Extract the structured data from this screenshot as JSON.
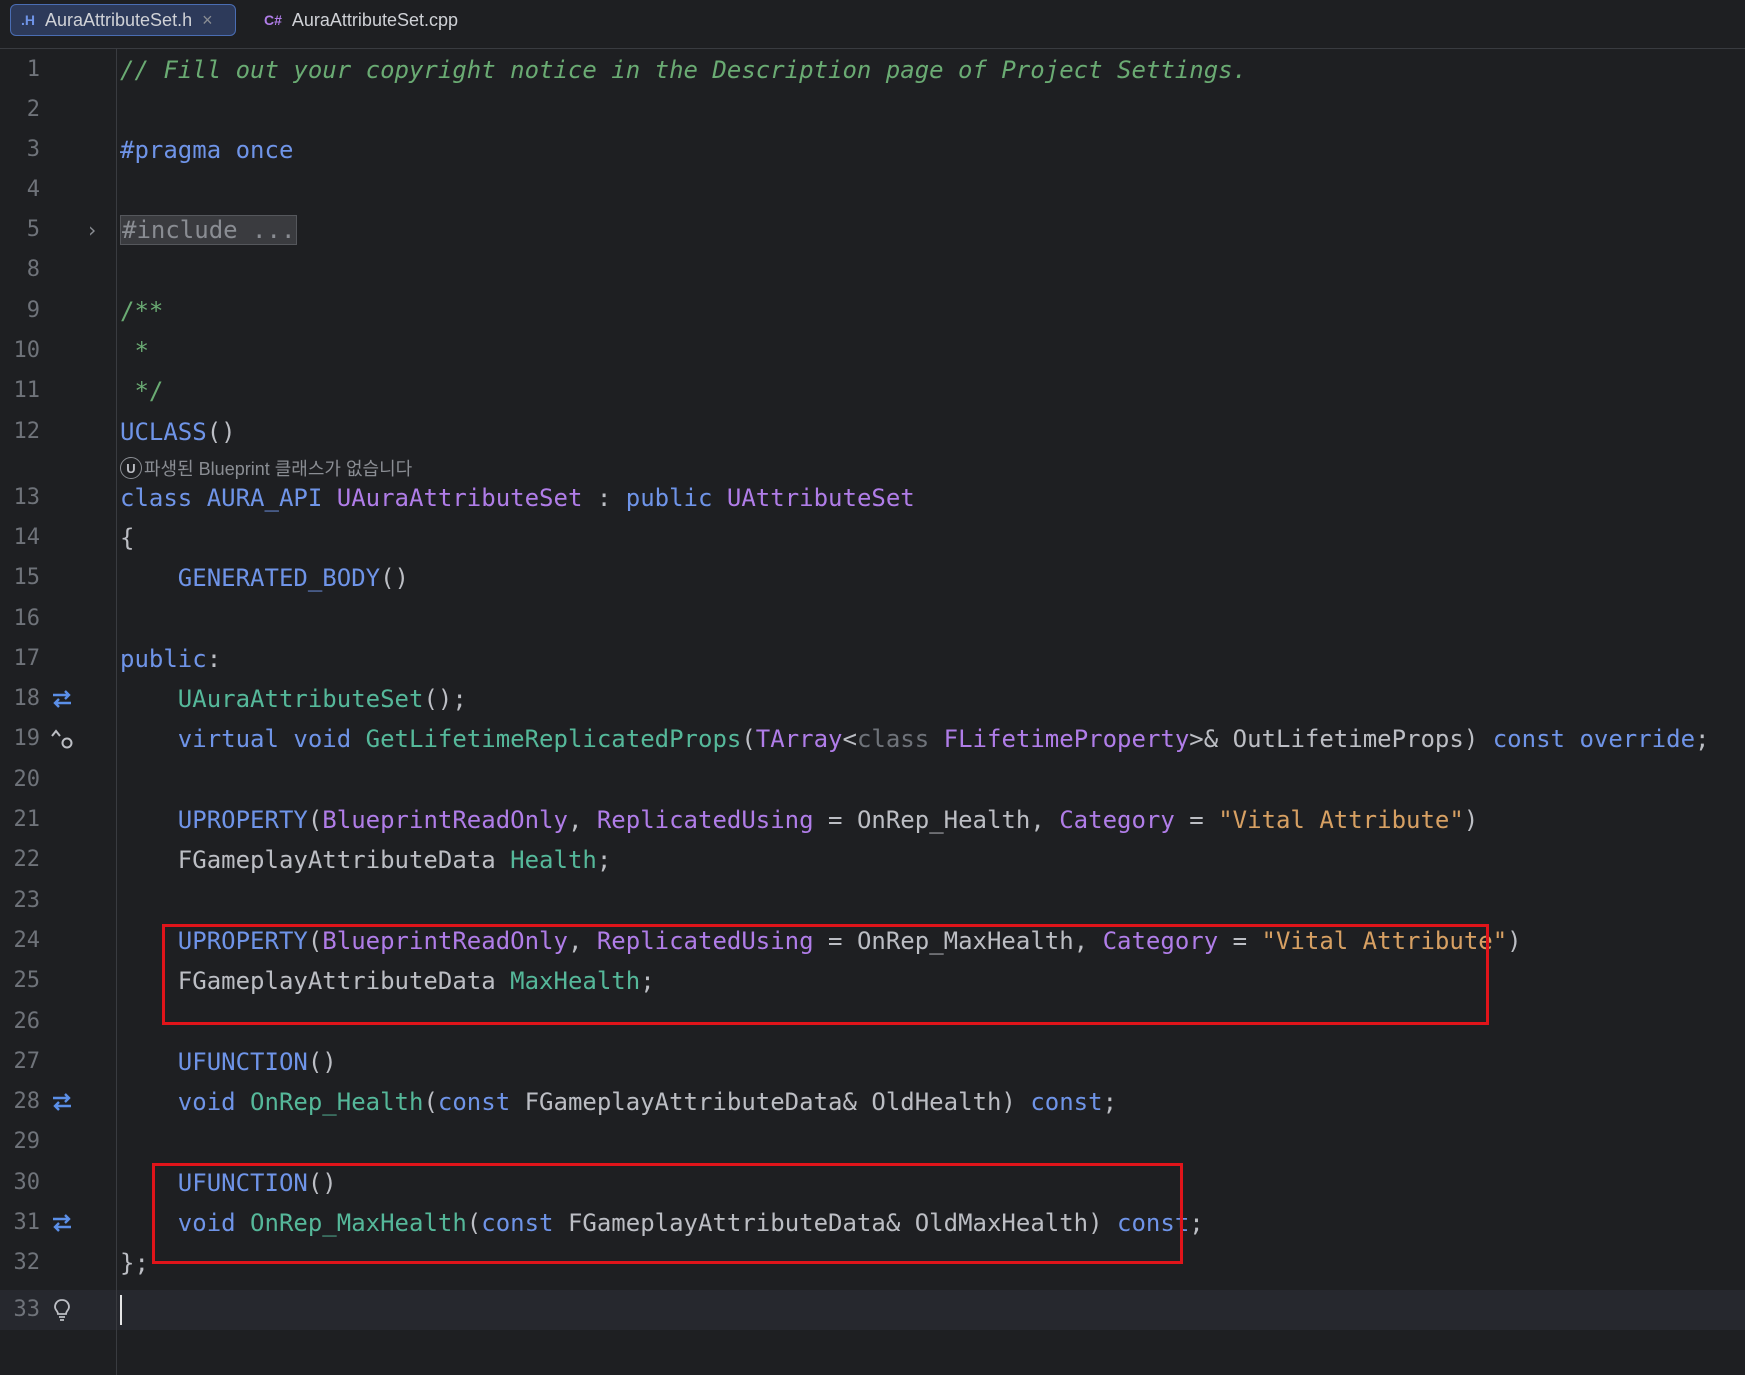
{
  "tabs": [
    {
      "icon": ".H",
      "label": "AuraAttributeSet.h",
      "close": "×",
      "active": true
    },
    {
      "icon": "C#",
      "label": "AuraAttributeSet.cpp",
      "active": false
    }
  ],
  "line_numbers": [
    "1",
    "2",
    "3",
    "4",
    "5",
    "8",
    "9",
    "10",
    "11",
    "12",
    "13",
    "14",
    "15",
    "16",
    "17",
    "18",
    "19",
    "20",
    "21",
    "22",
    "23",
    "24",
    "25",
    "26",
    "27",
    "28",
    "29",
    "30",
    "31",
    "32",
    "33"
  ],
  "code": {
    "l1": "// Fill out your copyright notice in the Description page of Project Settings.",
    "l3_kw": "#pragma",
    "l3_rest": " once",
    "l5": "#include ...",
    "l9": "/**",
    "l10": " *",
    "l11": " */",
    "l12_macro": "UCLASS",
    "l12_paren": "()",
    "hint": "파생된 Blueprint 클래스가 없습니다",
    "hint_badge": "U",
    "l13_class": "class",
    "l13_api": "AURA_API",
    "l13_name": "UAuraAttributeSet",
    "l13_colon": " : ",
    "l13_public": "public",
    "l13_base": "UAttributeSet",
    "l14": "{",
    "l15_macro": "GENERATED_BODY",
    "l15_paren": "()",
    "l17_public": "public",
    "l17_colon": ":",
    "l18_fn": "UAuraAttributeSet",
    "l18_rest": "();",
    "l19_virtual": "virtual",
    "l19_void": "void",
    "l19_fn": "GetLifetimeReplicatedProps",
    "l19_p1": "(",
    "l19_tarray": "TArray",
    "l19_lt": "<",
    "l19_class": "class",
    "l19_prop": "FLifetimeProperty",
    "l19_p2": ">& OutLifetimeProps) ",
    "l19_const": "const",
    "l19_override": "override",
    "l19_semi": ";",
    "l21_macro": "UPROPERTY",
    "l21_p1": "(",
    "l21_bro": "BlueprintReadOnly",
    "l21_comma1": ", ",
    "l21_ru": "ReplicatedUsing",
    "l21_eq": " = OnRep_Health, ",
    "l21_cat": "Category",
    "l21_eq2": " = ",
    "l21_str": "\"Vital Attribute\"",
    "l21_p2": ")",
    "l22_type": "FGameplayAttributeData",
    "l22_name": "Health",
    "l22_semi": ";",
    "l24_macro": "UPROPERTY",
    "l24_p1": "(",
    "l24_bro": "BlueprintReadOnly",
    "l24_comma1": ", ",
    "l24_ru": "ReplicatedUsing",
    "l24_eq": " = OnRep_MaxHealth, ",
    "l24_cat": "Category",
    "l24_eq2": " = ",
    "l24_str": "\"Vital Attribute\"",
    "l24_p2": ")",
    "l25_type": "FGameplayAttributeData",
    "l25_name": "MaxHealth",
    "l25_semi": ";",
    "l27_macro": "UFUNCTION",
    "l27_paren": "()",
    "l28_void": "void",
    "l28_fn": "OnRep_Health",
    "l28_p1": "(",
    "l28_const": "const",
    "l28_type": " FGameplayAttributeData& OldHealth) ",
    "l28_const2": "const",
    "l28_semi": ";",
    "l30_macro": "UFUNCTION",
    "l30_paren": "()",
    "l31_void": "void",
    "l31_fn": "OnRep_MaxHealth",
    "l31_p1": "(",
    "l31_const": "const",
    "l31_type": " FGameplayAttributeData& OldMaxHealth) ",
    "l31_const2": "const",
    "l31_semi": ";",
    "l32": "};"
  },
  "gutter_icons": {
    "implements": "implemented-arrows-icon",
    "override": "override-icon",
    "fold": "fold-chevron-icon",
    "bulb": "lightbulb-icon"
  },
  "colors": {
    "background": "#1e1f22",
    "comment": "#6aab73",
    "keyword": "#6f94e8",
    "type": "#b07de8",
    "function": "#55b89a",
    "string": "#d7a063",
    "highlight_box": "#e0141a"
  }
}
